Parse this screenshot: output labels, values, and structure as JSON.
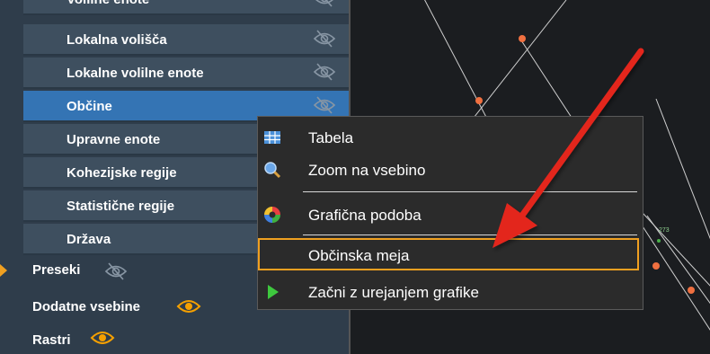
{
  "layers": {
    "items": [
      {
        "label": "Volilne enote"
      },
      {
        "label": "Lokalna volišča"
      },
      {
        "label": "Lokalne volilne enote"
      },
      {
        "label": "Občine"
      },
      {
        "label": "Upravne enote"
      },
      {
        "label": "Kohezijske regije"
      },
      {
        "label": "Statistične regije"
      },
      {
        "label": "Država"
      }
    ],
    "groups": [
      {
        "label": "Preseki"
      },
      {
        "label": "Dodatne vsebine"
      },
      {
        "label": "Rastri"
      }
    ]
  },
  "context_menu": {
    "items": [
      {
        "label": "Tabela",
        "icon": "table-icon"
      },
      {
        "label": "Zoom na vsebino",
        "icon": "magnifier-icon"
      },
      {
        "label": "Grafična podoba",
        "icon": "color-wheel-icon"
      },
      {
        "label": "Občinska meja",
        "icon": ""
      },
      {
        "label": "Začni z urejanjem grafike",
        "icon": "play-icon"
      }
    ]
  },
  "map": {
    "label_273": "273"
  },
  "colors": {
    "accent": "#3474b4",
    "highlight": "#f0a020",
    "arrow": "#e3261f"
  }
}
